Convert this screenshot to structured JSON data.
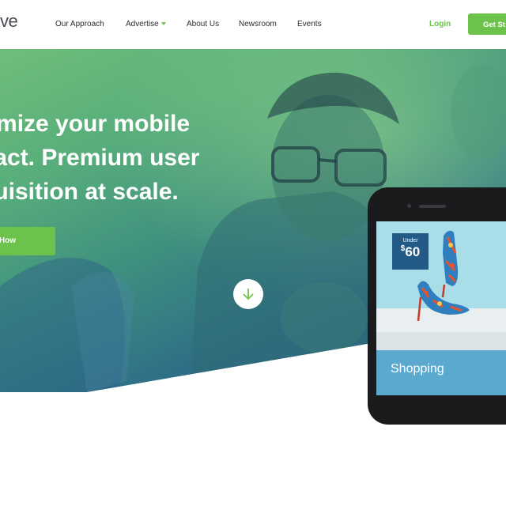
{
  "header": {
    "logo_text": "ve",
    "nav": [
      {
        "label": "Our Approach"
      },
      {
        "label": "Advertise"
      },
      {
        "label": "About Us"
      },
      {
        "label": "Newsroom"
      },
      {
        "label": "Events"
      }
    ],
    "login_label": "Login",
    "get_started_label": "Get St"
  },
  "hero": {
    "headline": [
      "ximize your mobile",
      "oact. Premium user",
      "quisition at scale."
    ],
    "cta_label": "n How"
  },
  "phone": {
    "price_prefix": "Under",
    "price_currency": "$",
    "price_value": "60",
    "shop_label": "Shopping"
  },
  "colors": {
    "accent": "#6cc24a",
    "hero_top": "#6fbe7a",
    "hero_bottom": "#1f5283",
    "shop_bar": "#5aa9cf"
  }
}
